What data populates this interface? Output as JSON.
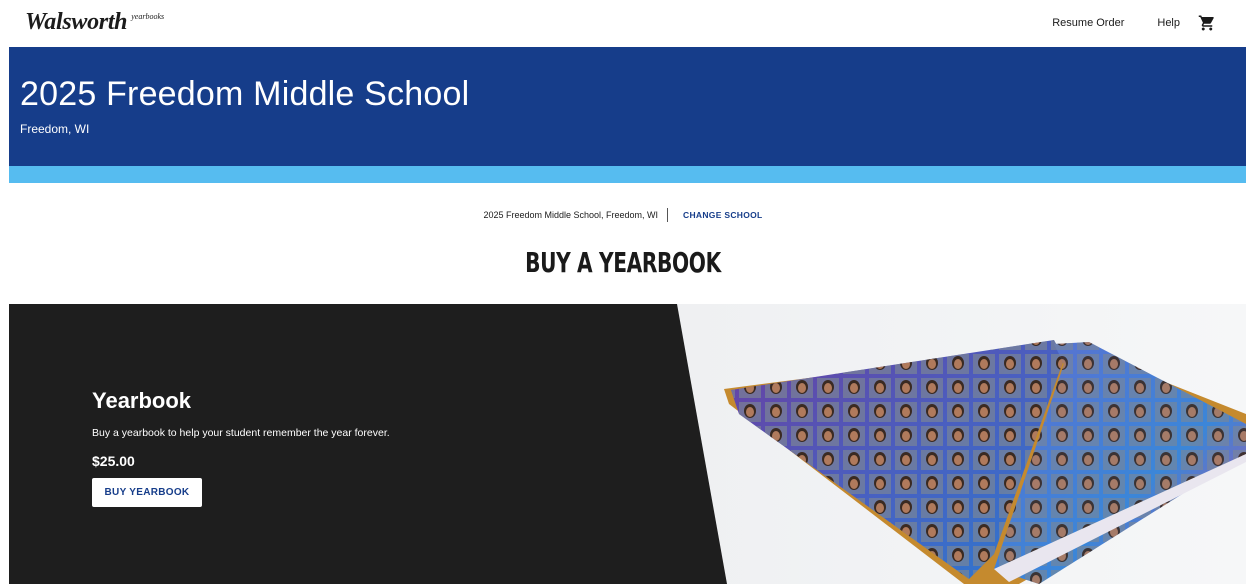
{
  "brand": {
    "name": "Walsworth",
    "tagline": "yearbooks"
  },
  "nav": {
    "resume_order": "Resume Order",
    "help": "Help",
    "cart_icon": "shopping-cart-icon"
  },
  "hero": {
    "title": "2025 Freedom Middle School",
    "location": "Freedom, WI"
  },
  "school_selector": {
    "current": "2025 Freedom Middle School, Freedom, WI",
    "change_label": "CHANGE SCHOOL"
  },
  "page": {
    "heading": "BUY A YEARBOOK"
  },
  "product": {
    "title": "Yearbook",
    "description": "Buy a yearbook to help your student remember the year forever.",
    "price": "$25.00",
    "button_label": "BUY YEARBOOK"
  },
  "colors": {
    "hero_blue": "#163d8a",
    "stripe_light_blue": "#56bcf0",
    "panel_dark": "#1e1e1e",
    "link_blue": "#163d8a"
  }
}
